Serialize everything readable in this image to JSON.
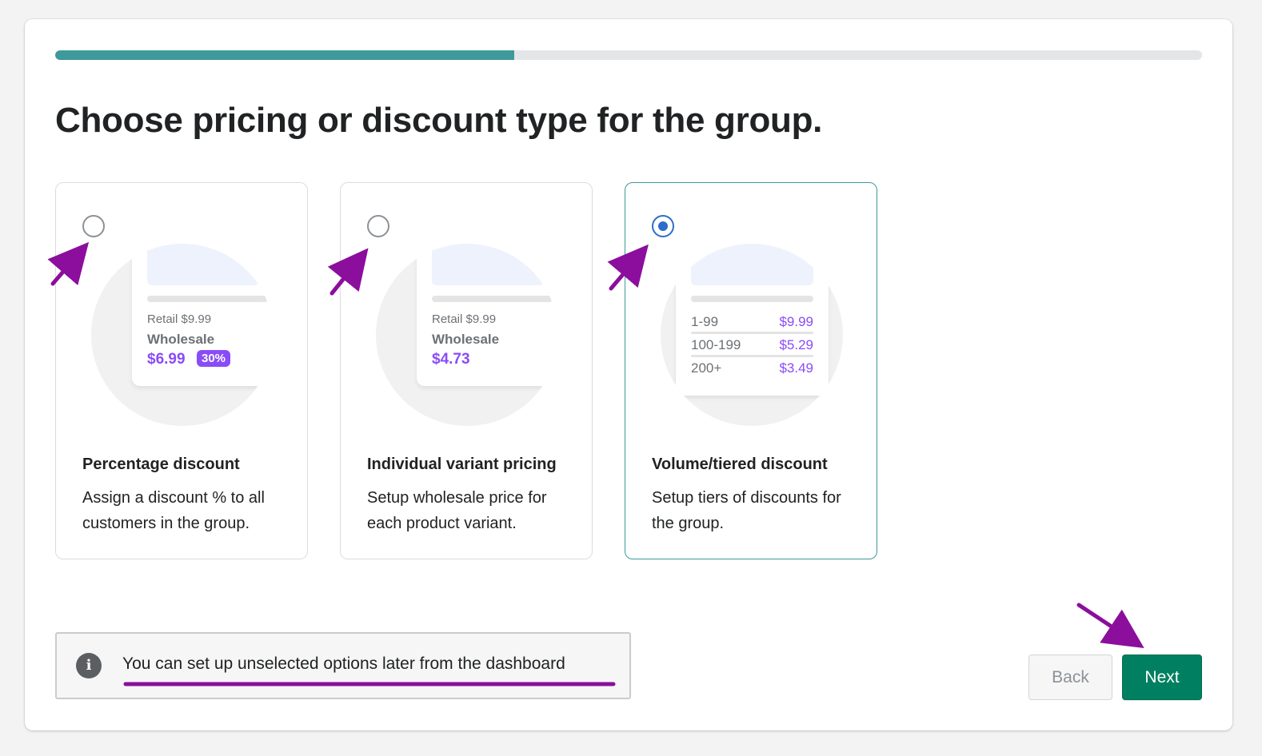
{
  "wizard": {
    "progress_fraction": 0.4,
    "title": "Choose pricing or discount type for the group."
  },
  "options": [
    {
      "title": "Percentage discount",
      "description": "Assign a discount % to all customers in the group.",
      "selected": false,
      "illustration": {
        "retail": "Retail $9.99",
        "wholesale": "Wholesale",
        "price": "$6.99",
        "badge": "30%"
      }
    },
    {
      "title": "Individual variant pricing",
      "description": "Setup wholesale price for each product variant.",
      "selected": false,
      "illustration": {
        "retail": "Retail $9.99",
        "wholesale": "Wholesale",
        "price": "$4.73"
      }
    },
    {
      "title": "Volume/tiered discount",
      "description": "Setup tiers of discounts for the group.",
      "selected": true,
      "illustration": {
        "tiers": [
          {
            "qty": "1-99",
            "price": "$9.99"
          },
          {
            "qty": "100-199",
            "price": "$5.29"
          },
          {
            "qty": "200+",
            "price": "$3.49"
          }
        ]
      }
    }
  ],
  "info": {
    "icon": "info-icon",
    "icon_glyph": "i",
    "text": "You can set up unselected options later from the dashboard"
  },
  "actions": {
    "back_label": "Back",
    "next_label": "Next"
  },
  "colors": {
    "progress": "#3e9a9a",
    "primary": "#008060",
    "radio_selected": "#2c6ecb",
    "accent_price": "#8a4cf7",
    "annotation": "#8b0e9c"
  }
}
